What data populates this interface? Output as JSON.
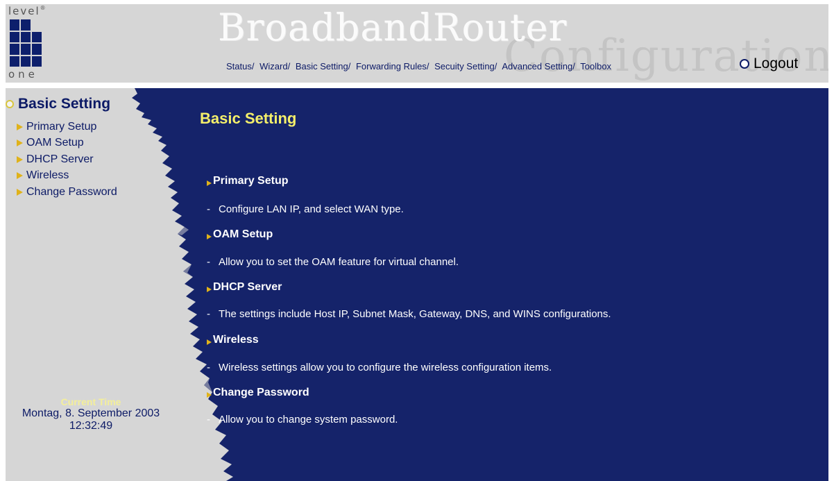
{
  "colors": {
    "navy": "#0c1a66",
    "panel_gray": "#d6d6d6",
    "accent_yellow": "#f4ef6a",
    "bullet_gold": "#e0b21a"
  },
  "logo": {
    "top": "level",
    "tm": "®",
    "bottom": "one"
  },
  "brand": {
    "title": "BroadbandRouter",
    "subtitle": "Configuration"
  },
  "topnav": [
    {
      "label": "Status",
      "sep": "/"
    },
    {
      "label": "Wizard",
      "sep": "/"
    },
    {
      "label": "Basic Setting",
      "sep": "/"
    },
    {
      "label": "Forwarding Rules",
      "sep": "/"
    },
    {
      "label": "Secuity Setting",
      "sep": "/"
    },
    {
      "label": "Advanced Setting",
      "sep": "/"
    },
    {
      "label": "Toolbox",
      "sep": ""
    }
  ],
  "logout": {
    "label": "Logout",
    "icon": "circle-ring-icon"
  },
  "sidebar": {
    "title": "Basic Setting",
    "items": [
      {
        "label": "Primary Setup"
      },
      {
        "label": "OAM Setup"
      },
      {
        "label": "DHCP Server"
      },
      {
        "label": "Wireless"
      },
      {
        "label": "Change Password"
      }
    ]
  },
  "time": {
    "label": "Current Time",
    "date": "Montag, 8. September 2003",
    "clock": "12:32:49"
  },
  "main": {
    "title": "Basic Setting",
    "entries": [
      {
        "title": "Primary Setup",
        "dash": "-",
        "desc": "Configure LAN IP, and select WAN type."
      },
      {
        "title": "OAM Setup",
        "dash": "-",
        "desc": "Allow you to set the OAM feature for virtual channel."
      },
      {
        "title": "DHCP Server",
        "dash": "-",
        "desc": "The settings include Host IP, Subnet Mask, Gateway, DNS, and WINS configurations."
      },
      {
        "title": "Wireless",
        "dash": "-",
        "desc": "Wireless settings allow you to configure the wireless configuration items."
      },
      {
        "title": "Change Password",
        "dash": "-",
        "desc": "Allow you to change system password."
      }
    ]
  }
}
